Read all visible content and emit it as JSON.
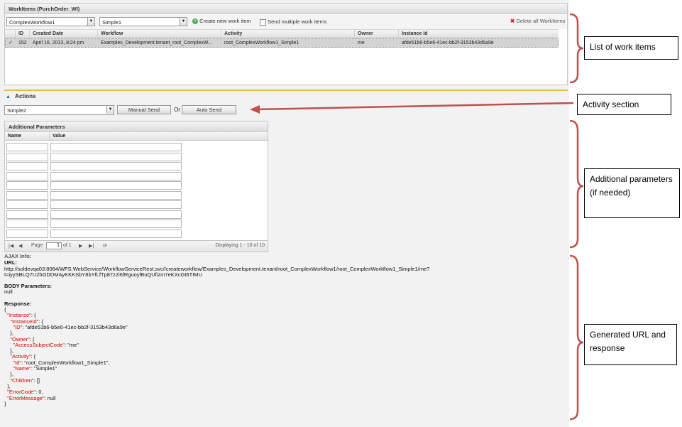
{
  "workitems": {
    "title": "WorkItems (PurchOrder_WI)",
    "workflow_select": "ComplexWorkflow1",
    "activity_select": "Simple1",
    "create_label": "Create new work item",
    "send_multiple_label": "Send multiple work items",
    "delete_all_label": "Delete all WorkItems",
    "columns": [
      "ID",
      "Created Date",
      "Workflow",
      "Activity",
      "Owner",
      "Instance Id"
    ],
    "rows": [
      {
        "id": "152",
        "created": "April 16, 2013, 8:24 pm",
        "workflow": "Examples_Development.tenant_root_ComplexW...",
        "activity": "root_ComplexWorkflow1_Simple1",
        "owner": "me",
        "instance": "afde51b6-b5e6-41ec-bb2f-3153b43d6a9e"
      }
    ]
  },
  "actions": {
    "title": "Actions",
    "activity_select": "Simple2",
    "manual_send": "Manual Send",
    "or_label": "Or",
    "auto_send": "Auto Send"
  },
  "params": {
    "title": "Additional Parameters",
    "col_name": "Name",
    "col_value": "Value",
    "page_label": "Page",
    "page_value": "1",
    "of_label": "of 1",
    "displaying": "Displaying 1 - 10 of 10"
  },
  "ajax": {
    "info_label": "AJAX Info:",
    "url_label": "URL:",
    "url_line1": "http://soldevqa03:8084/WFS.WebService/WorkflowServiceRest.svc//createworkflow/Examples_Development.tenant/root_ComplexWorkflow1/root_ComplexWorkflow1_Simple1/me?",
    "url_line2": "t=iyySBLQ7U2hGDDMAyKKKSbY8bYfLfTp87z2i6fRguoylBuQUfizm7eKXcGt6TIMU",
    "body_label": "BODY Parameters:",
    "body_value": "null",
    "response_label": "Response:",
    "json": {
      "open": "{",
      "instance_key": "\"Instance\"",
      "instanceid_key": "\"InstanceId\"",
      "id_key": "\"ID\"",
      "id_value": "\"afde51b6-b5e6-41ec-bb2f-3153b43d6a9e\"",
      "owner_key": "\"Owner\"",
      "asc_key": "\"AccessSubjectCode\"",
      "asc_value": "\"me\"",
      "activity_key": "\"Activity\"",
      "aid_key": "\"Id\"",
      "aid_value": "\"root_ComplexWorkflow1_Simple1\",",
      "name_key": "\"Name\"",
      "name_value": "\"Simple1\"",
      "children_key": "\"Children\"",
      "children_value": "[]",
      "errorcode_key": "\"ErrorCode\"",
      "errorcode_value": "0,",
      "errormsg_key": "\"ErrorMessage\"",
      "errormsg_value": "null",
      "close": "}"
    }
  },
  "annotations": {
    "list": "List of work items",
    "activity": "Activity section",
    "params": "Additional parameters (if needed)",
    "generated": "Generated URL and response"
  },
  "colors": {
    "accent_orange": "#f0b25a",
    "bracket_red": "#c0504d",
    "json_key_red": "#d40000"
  }
}
